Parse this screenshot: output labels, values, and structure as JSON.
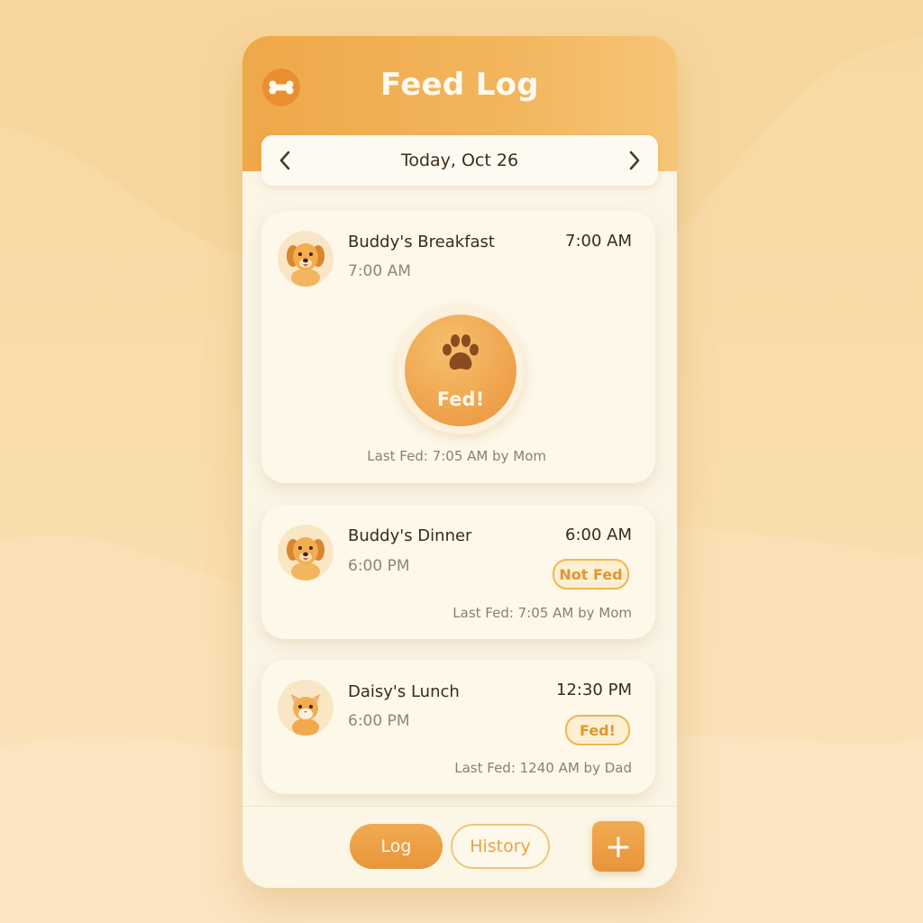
{
  "app": {
    "title": "Feed Log"
  },
  "date_nav": {
    "label": "Today, Oct 26",
    "prev_icon": "chevron-left-icon",
    "next_icon": "chevron-right-icon"
  },
  "entries": [
    {
      "name": "Buddy's Breakfast",
      "scheduled": "7:00 AM",
      "time": "7:00 AM",
      "status": "Fed!",
      "last_fed": "Last Fed: 7:05 AM by Mom",
      "pet": "dog"
    },
    {
      "name": "Buddy's Dinner",
      "scheduled": "6:00 PM",
      "time": "6:00 AM",
      "status": "Not Fed",
      "last_fed": "Last Fed: 7:05 AM by Mom",
      "pet": "dog"
    },
    {
      "name": "Daisy's Lunch",
      "scheduled": "6:00 PM",
      "time": "12:30 PM",
      "status": "Fed!",
      "last_fed": "Last Fed: 1240 AM by Dad",
      "pet": "cat"
    }
  ],
  "footer": {
    "log_label": "Log",
    "history_label": "History",
    "add_label": "+"
  },
  "colors": {
    "accent": "#eea04a",
    "header": "#f2b55c",
    "card": "#fdf8e9",
    "text": "#3a2b1a"
  }
}
